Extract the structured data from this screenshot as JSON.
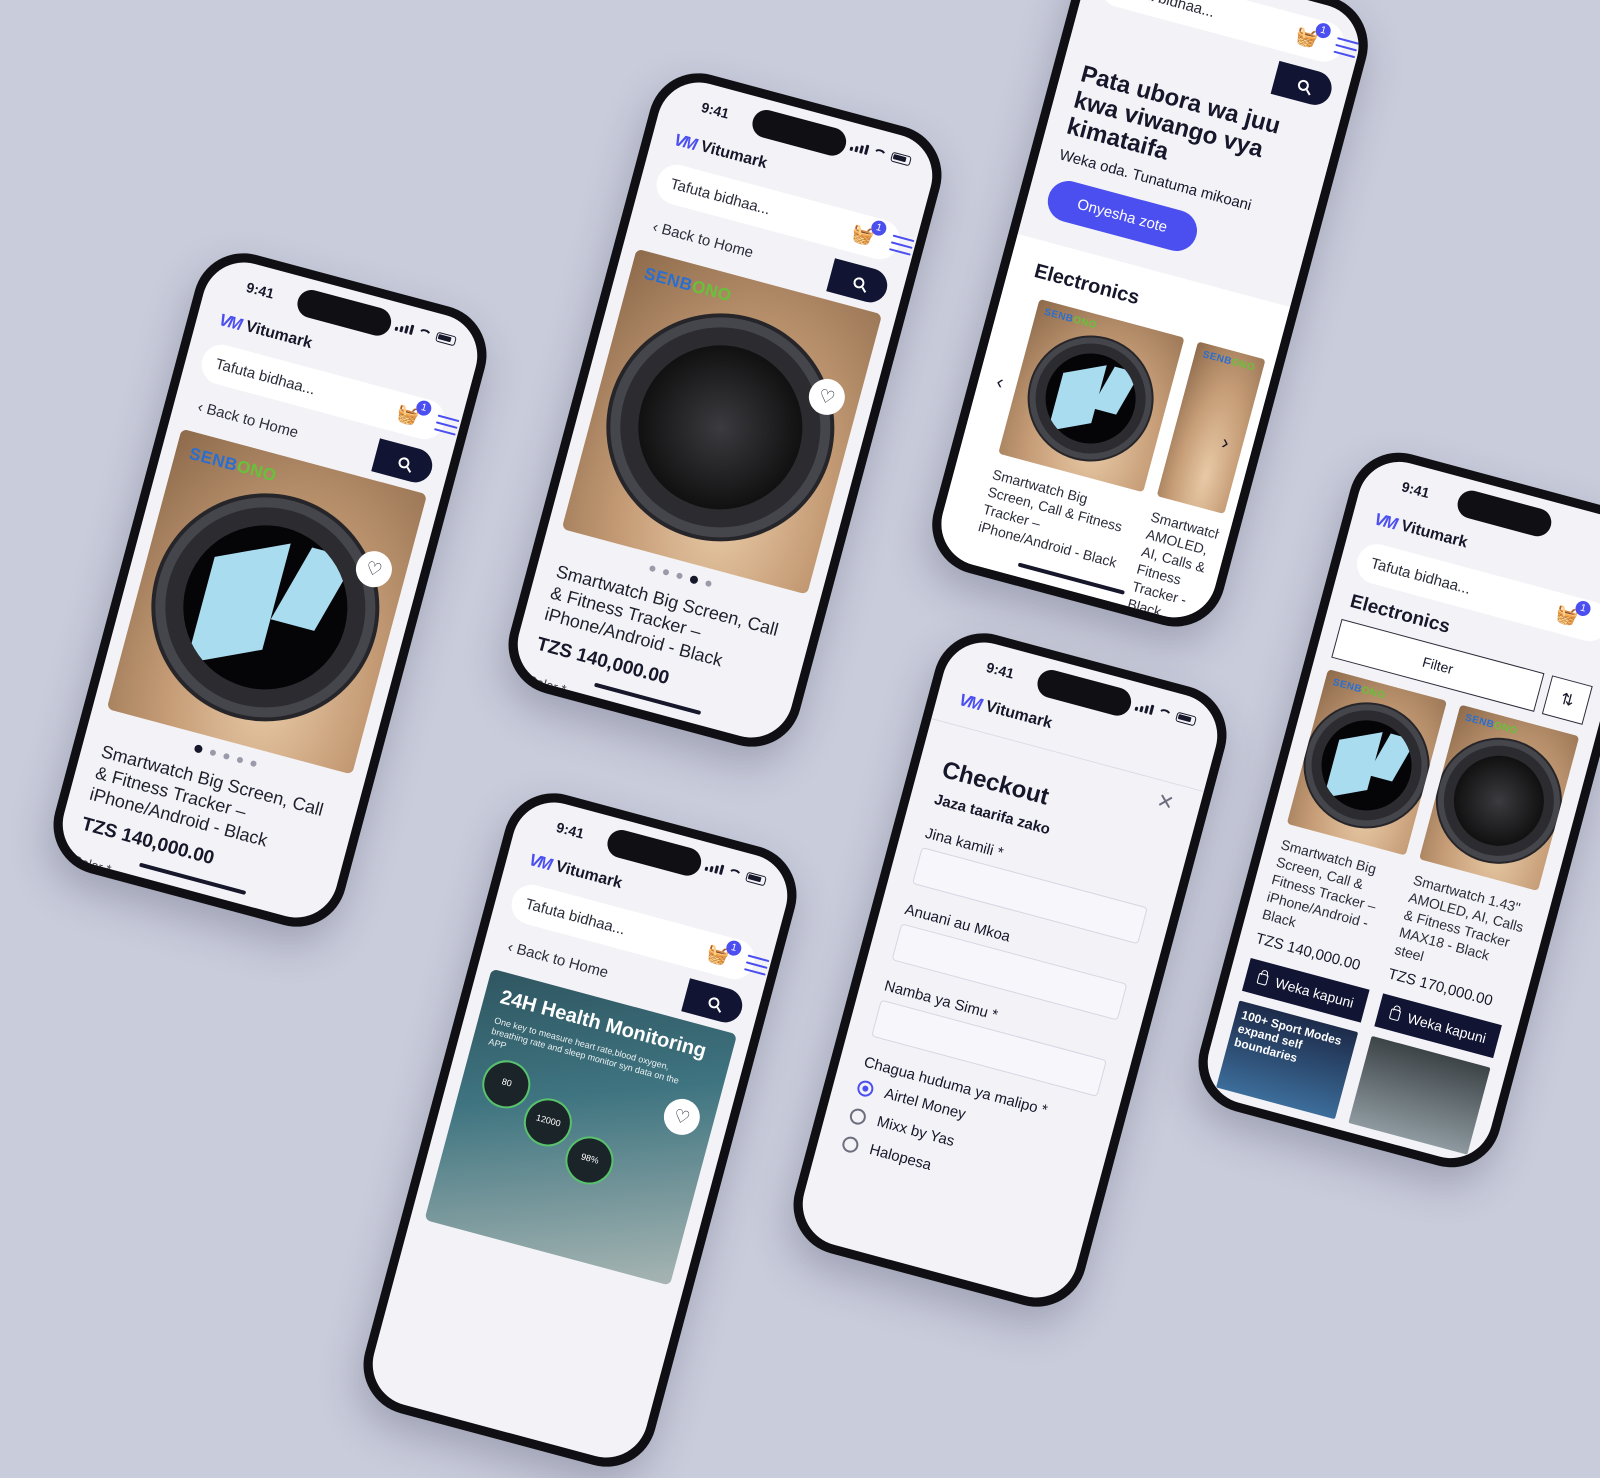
{
  "common": {
    "time": "9:41",
    "brand": "Vitumark",
    "logo_mark": "VM",
    "search_placeholder": "Tafuta bidhaa...",
    "cart_count": "1",
    "back_label": "Back to Home",
    "heart_icon": "♡",
    "back_icon": "‹"
  },
  "product": {
    "brand_tag_a": "SENB",
    "brand_tag_b": "ONO",
    "title": "Smartwatch Big Screen, Call & Fitness Tracker – iPhone/Android - Black",
    "price": "TZS 140,000.00",
    "color_label": "Color *",
    "carousel_total": 5,
    "carousel_active_left": 1,
    "carousel_active_mid": 4
  },
  "health": {
    "headline": "24H Health Monitoring",
    "subline": "One key to measure heart rate,blood oxygen, breathing rate and sleep monitor syn data on the APP",
    "stat_1": "80",
    "stat_2": "12000",
    "stat_3": "98%"
  },
  "home": {
    "hero_title": "Pata ubora wa juu kwa viwango vya kimataifa",
    "hero_sub": "Weka oda. Tunatuma mikoani",
    "cta": "Onyesha zote",
    "section_title": "Electronics",
    "card_1_title": "Smartwatch Big Screen, Call & Fitness Tracker – iPhone/Android - Black",
    "card_2_title": "Smartwatch AMOLED, AI, Calls & Fitness Tracker - Black",
    "prev_icon": "‹",
    "next_icon": "›"
  },
  "checkout": {
    "title": "Checkout",
    "subtitle": "Jaza taarifa zako",
    "field_name": "Jina kamili *",
    "field_address": "Anuani au Mkoa",
    "field_phone": "Namba ya Simu *",
    "payment_label": "Chagua huduma ya malipo *",
    "payment_options": [
      "Airtel Money",
      "Mixx by Yas",
      "Halopesa"
    ],
    "close_icon": "✕"
  },
  "category": {
    "title": "Electronics",
    "filter_label": "Filter",
    "sort_icon": "⇅",
    "items": [
      {
        "title": "Smartwatch Big Screen, Call & Fitness Tracker – iPhone/Android - Black",
        "price": "TZS 140,000.00",
        "button": "Weka kapuni"
      },
      {
        "title": "Smartwatch 1.43\" AMOLED, AI, Calls & Fitness Tracker MAX18 - Black steel",
        "price": "TZS 170,000.00",
        "button": "Weka kapuni"
      }
    ],
    "promo_1": "100+ Sport Modes expand self boundaries",
    "promo_2": ""
  },
  "colors": {
    "accent": "#4b4ff0",
    "dark_button": "#111433",
    "background": "#c9ccdb"
  }
}
